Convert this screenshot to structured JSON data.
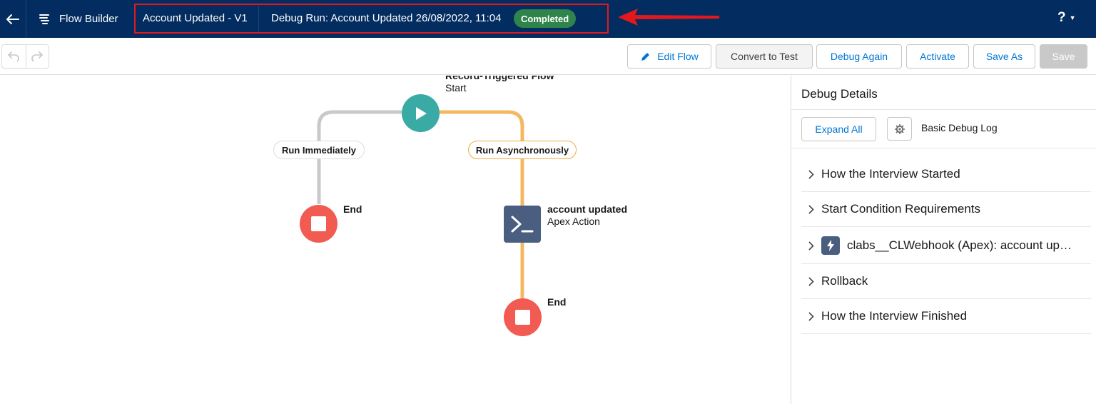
{
  "header": {
    "app_label": "Flow Builder",
    "flow_title": "Account Updated - V1",
    "debug_run_title": "Debug Run: Account Updated 26/08/2022, 11:04",
    "status_badge": "Completed",
    "help_label": "?",
    "colors": {
      "background": "#032d60",
      "badge": "#2e844a",
      "annotation": "#e3181d"
    }
  },
  "toolbar": {
    "edit_flow": "Edit Flow",
    "convert_to_test": "Convert to Test",
    "debug_again": "Debug Again",
    "activate": "Activate",
    "save_as": "Save As",
    "save": "Save"
  },
  "canvas": {
    "start_node": {
      "title": "Record-Triggered Flow",
      "subtitle": "Start",
      "icon": "play-icon",
      "color": "#3aaba4"
    },
    "paths": [
      {
        "label": "Run Immediately",
        "color": "#c9c9c9"
      },
      {
        "label": "Run Asynchronously",
        "color": "#f4b860"
      }
    ],
    "end_label": "End",
    "end_color": "#f25b52",
    "apex_node": {
      "title": "account updated",
      "subtitle": "Apex Action",
      "icon": "terminal-icon",
      "color": "#4a5e80"
    }
  },
  "debug_panel": {
    "title": "Debug Details",
    "expand_all": "Expand All",
    "log_level": "Basic Debug Log",
    "sections": [
      {
        "label": "How the Interview Started"
      },
      {
        "label": "Start Condition Requirements"
      },
      {
        "label": "clabs__CLWebhook (Apex): account updated",
        "icon": "lightning-icon"
      },
      {
        "label": "Rollback"
      },
      {
        "label": "How the Interview Finished"
      }
    ]
  }
}
